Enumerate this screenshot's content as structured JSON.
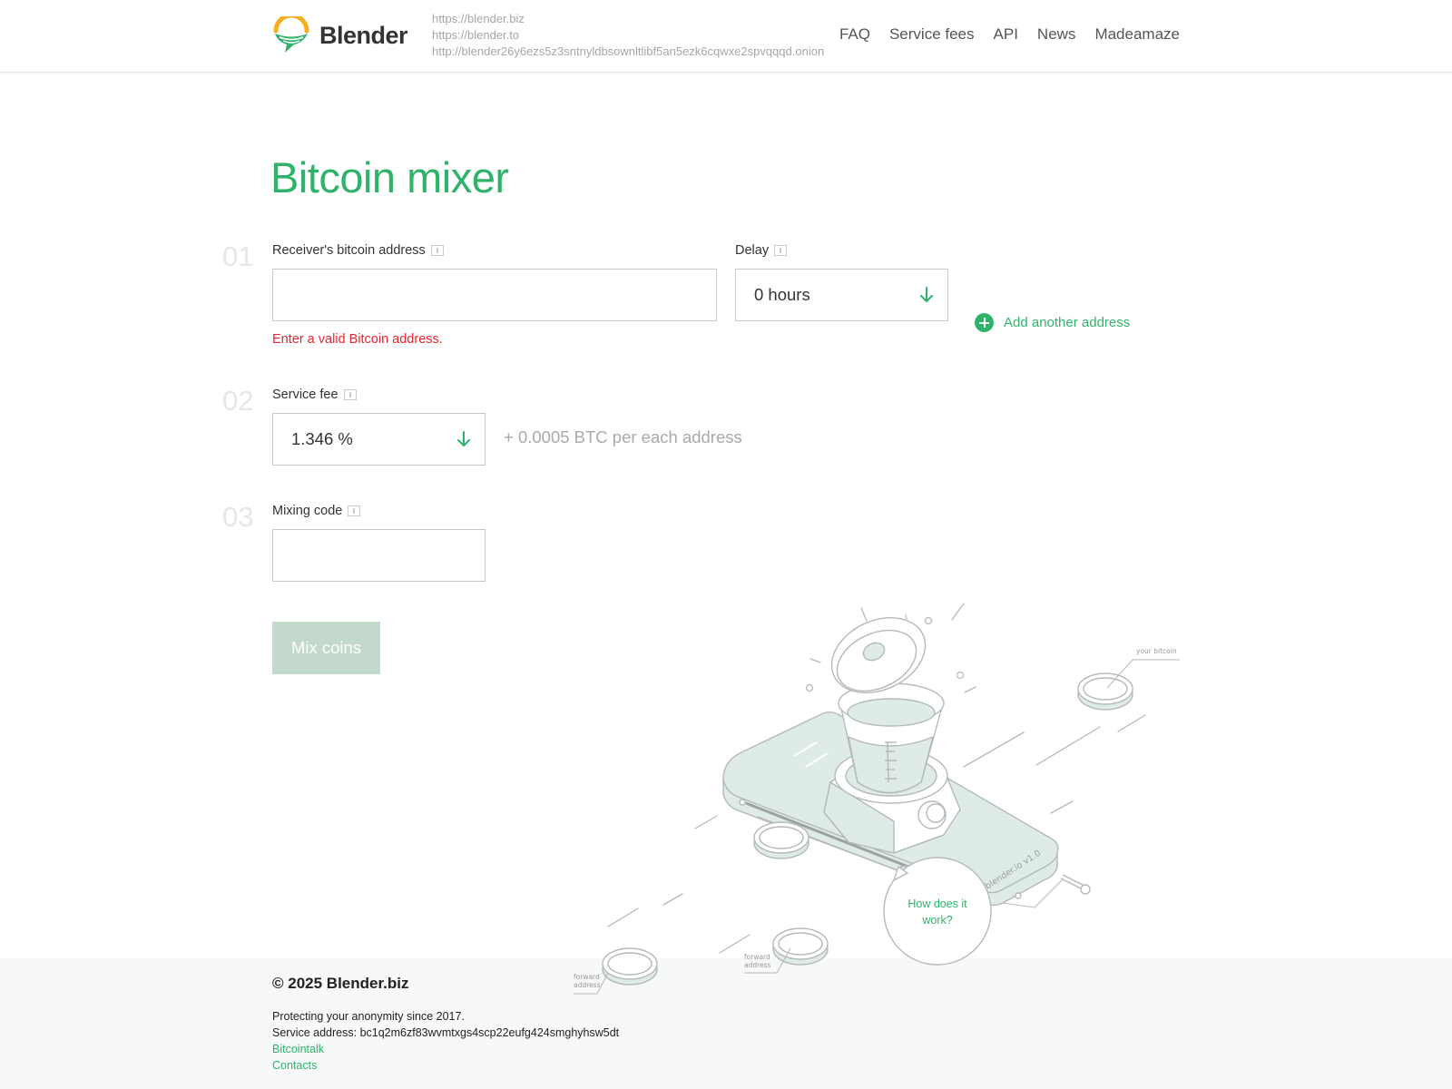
{
  "header": {
    "brand": "Blender",
    "mirrors": [
      "https://blender.biz",
      "https://blender.to",
      "http://blender26y6ezs5z3sntnyldbsownltlibf5an5ezk6cqwxe2spvqqqd.onion"
    ],
    "nav": [
      "FAQ",
      "Service fees",
      "API",
      "News",
      "Madeamaze"
    ]
  },
  "main": {
    "title": "Bitcoin mixer",
    "steps": [
      "01",
      "02",
      "03"
    ],
    "receiver": {
      "label": "Receiver's bitcoin address",
      "value": "",
      "error": "Enter a valid Bitcoin address."
    },
    "delay": {
      "label": "Delay",
      "value": "0 hours"
    },
    "add_address_label": "Add another address",
    "service_fee": {
      "label": "Service fee",
      "value": "1.346 %",
      "note": "+ 0.0005 BTC per each address"
    },
    "mixing_code": {
      "label": "Mixing code",
      "value": ""
    },
    "mix_button": "Mix coins"
  },
  "illustration": {
    "speech_line1": "How does it",
    "speech_line2": "work?",
    "device_label": "blender.io v1.0",
    "your_bitcoin": "your bitcoin",
    "forward_line1": "forward",
    "forward_line2": "address"
  },
  "footer": {
    "copyright": "© 2025 Blender.biz",
    "tagline": "Protecting your anonymity since 2017.",
    "service_address": "Service address: bc1q2m6zf83wvmtxgs4scp22eufg424smghyhsw5dt",
    "links": [
      "Bitcointalk",
      "Contacts"
    ]
  },
  "colors": {
    "accent": "#2fb36a",
    "error": "#e8262e",
    "button_disabled": "#c2d9cc",
    "illustration_fill": "#dfece5"
  }
}
